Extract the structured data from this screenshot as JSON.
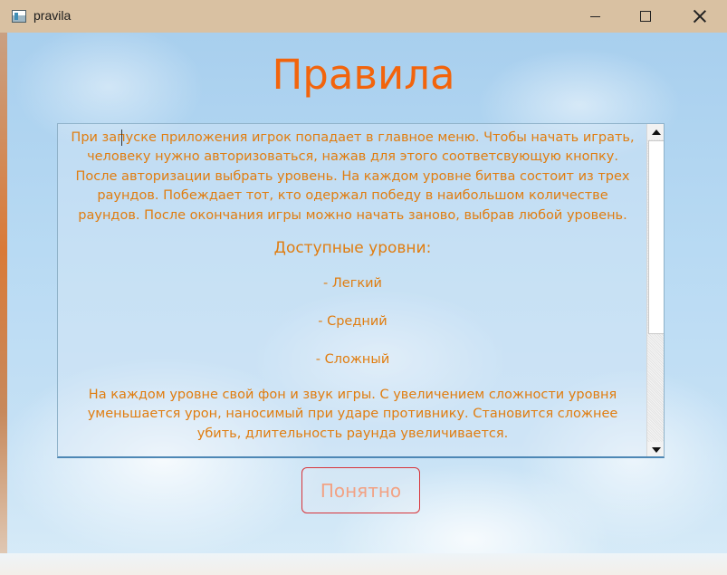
{
  "window": {
    "title": "pravila",
    "controls": {
      "minimize": "minimize-icon",
      "maximize": "maximize-icon",
      "close": "close-icon"
    }
  },
  "page": {
    "title": "Правила"
  },
  "rules": {
    "intro": "При запуске приложения игрок попадает в главное меню. Чтобы начать играть, человеку нужно авторизоваться, нажав для этого соответсвующую кнопку. После авторизации выбрать уровень. На каждом уровне битва состоит из трех раундов. Побеждает тот, кто одержал победу в наибольшом количестве раундов. После окончания игры можно начать заново, выбрав любой уровень.",
    "levels_heading": "Доступные уровни:",
    "levels": [
      "- Легкий",
      "- Средний",
      "- Сложный"
    ],
    "outro": "На каждом уровне свой фон и звук игры. С увеличением сложности уровня уменьшается урон, наносимый при ударе противнику. Становится сложнее убить, длительность раунда увеличивается."
  },
  "actions": {
    "confirm_label": "Понятно"
  },
  "colors": {
    "title": "#f2640c",
    "text": "#e07d10",
    "button_border": "#d7343a",
    "titlebar": "#d9c1a2"
  }
}
